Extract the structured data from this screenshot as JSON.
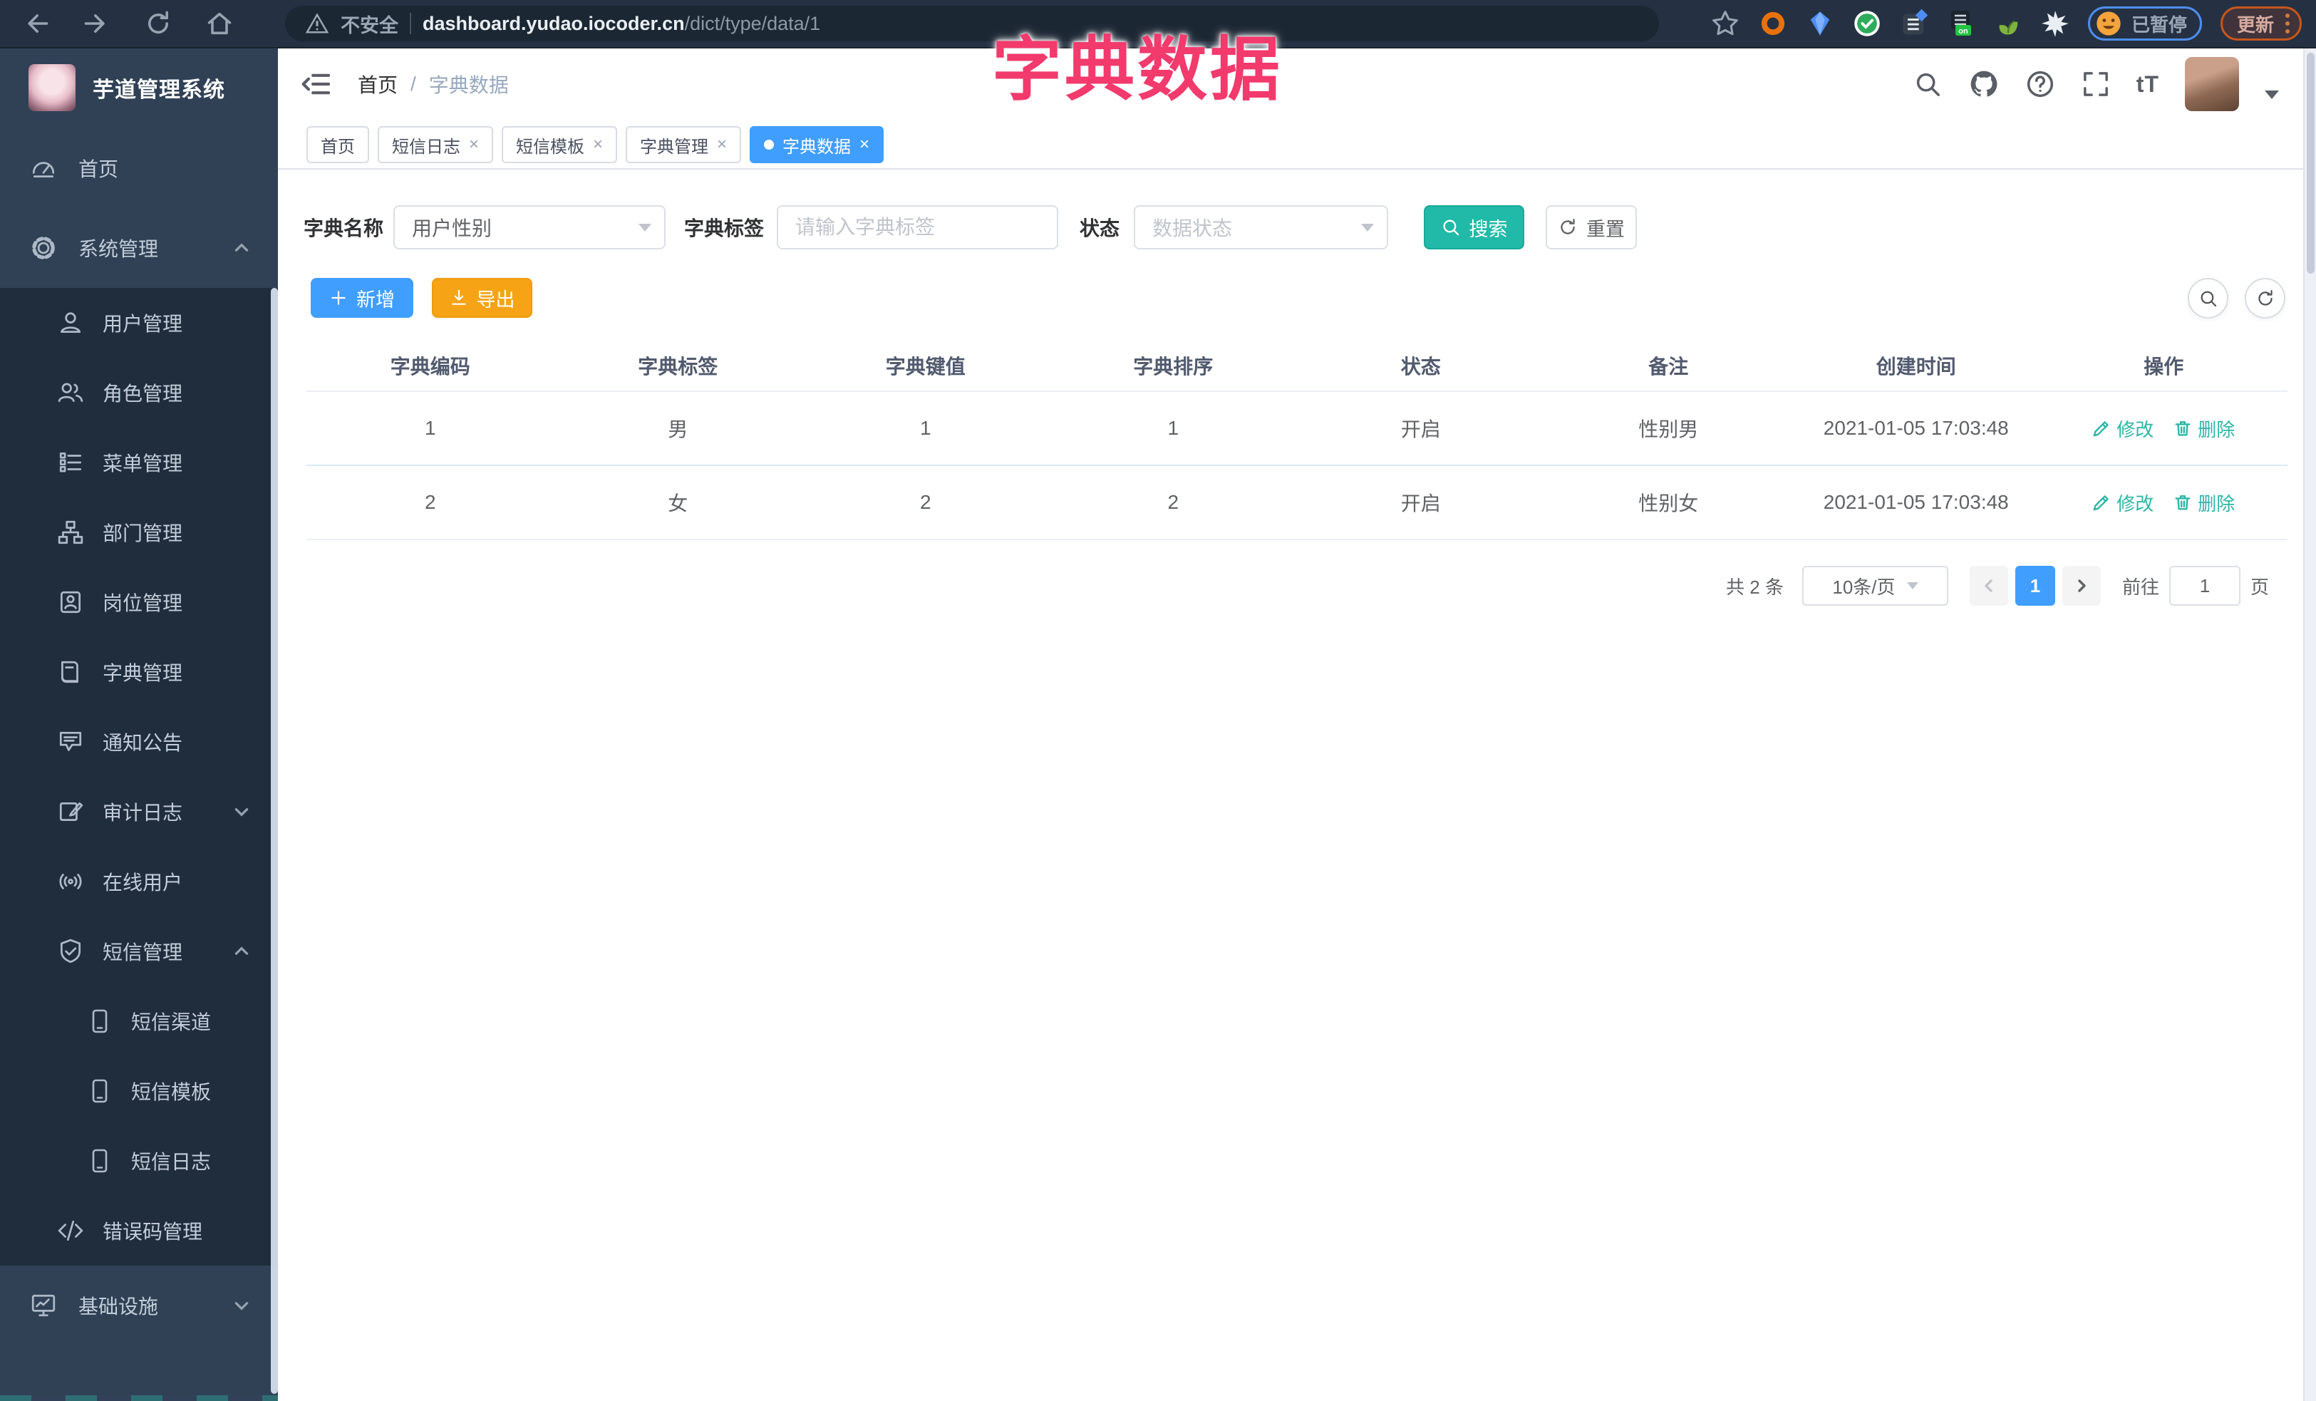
{
  "browser": {
    "security_warning": "不安全",
    "url_domain": "dashboard.yudao.iocoder.cn",
    "url_path": "/dict/type/data/1",
    "extension_on_badge": "on",
    "paused_badge": "已暂停",
    "update_button": "更新"
  },
  "annotation": {
    "title": "字典数据",
    "color": "#f23a6d"
  },
  "sidebar": {
    "logo_title": "芋道管理系统",
    "items": [
      {
        "label": "首页",
        "icon": "dashboard-icon",
        "level": 1
      },
      {
        "label": "系统管理",
        "icon": "gear-icon",
        "level": 1,
        "arrow": "up"
      },
      {
        "label": "用户管理",
        "icon": "user-icon",
        "level": 2
      },
      {
        "label": "角色管理",
        "icon": "users-icon",
        "level": 2
      },
      {
        "label": "菜单管理",
        "icon": "menu-list-icon",
        "level": 2
      },
      {
        "label": "部门管理",
        "icon": "org-tree-icon",
        "level": 2
      },
      {
        "label": "岗位管理",
        "icon": "id-badge-icon",
        "level": 2
      },
      {
        "label": "字典管理",
        "icon": "dict-book-icon",
        "level": 2
      },
      {
        "label": "通知公告",
        "icon": "announcement-icon",
        "level": 2
      },
      {
        "label": "审计日志",
        "icon": "audit-log-icon",
        "level": 2,
        "arrow": "down"
      },
      {
        "label": "在线用户",
        "icon": "online-users-icon",
        "level": 2
      },
      {
        "label": "短信管理",
        "icon": "sms-shield-icon",
        "level": 2,
        "arrow": "up"
      },
      {
        "label": "短信渠道",
        "icon": "phone-icon",
        "level": 3
      },
      {
        "label": "短信模板",
        "icon": "phone-icon",
        "level": 3
      },
      {
        "label": "短信日志",
        "icon": "phone-icon",
        "level": 3
      },
      {
        "label": "错误码管理",
        "icon": "code-icon",
        "level": 2
      },
      {
        "label": "基础设施",
        "icon": "infra-icon",
        "level": 1,
        "arrow": "down"
      }
    ]
  },
  "header": {
    "breadcrumb_home": "首页",
    "breadcrumb_sep": "/",
    "breadcrumb_current": "字典数据"
  },
  "tabs": [
    {
      "label": "首页",
      "closable": false,
      "active": false
    },
    {
      "label": "短信日志",
      "closable": true,
      "active": false
    },
    {
      "label": "短信模板",
      "closable": true,
      "active": false
    },
    {
      "label": "字典管理",
      "closable": true,
      "active": false
    },
    {
      "label": "字典数据",
      "closable": true,
      "active": true
    }
  ],
  "close_glyph": "×",
  "filters": {
    "dict_name_label": "字典名称",
    "dict_name_value": "用户性别",
    "dict_label_label": "字典标签",
    "dict_label_placeholder": "请输入字典标签",
    "status_label": "状态",
    "status_placeholder": "数据状态",
    "search_button": "搜索",
    "reset_button": "重置"
  },
  "toolbar": {
    "add_button": "新增",
    "export_button": "导出"
  },
  "table": {
    "headers": [
      "字典编码",
      "字典标签",
      "字典键值",
      "字典排序",
      "状态",
      "备注",
      "创建时间",
      "操作"
    ],
    "rows": [
      {
        "code": "1",
        "label": "男",
        "value": "1",
        "sort": "1",
        "status": "开启",
        "remark": "性别男",
        "created": "2021-01-05 17:03:48",
        "edit": "修改",
        "delete": "删除"
      },
      {
        "code": "2",
        "label": "女",
        "value": "2",
        "sort": "2",
        "status": "开启",
        "remark": "性别女",
        "created": "2021-01-05 17:03:48",
        "edit": "修改",
        "delete": "删除"
      }
    ]
  },
  "pagination": {
    "total": "共 2 条",
    "page_size": "10条/页",
    "current_page": "1",
    "goto_label": "前往",
    "goto_value": "1",
    "page_suffix": "页"
  },
  "colors": {
    "primary_blue": "#409eff",
    "search_teal": "#21b9a7",
    "export_orange": "#f6a415",
    "sidebar_bg": "#304156",
    "submenu_bg": "#1f2d3d",
    "annotation_pink": "#f23a6d"
  }
}
